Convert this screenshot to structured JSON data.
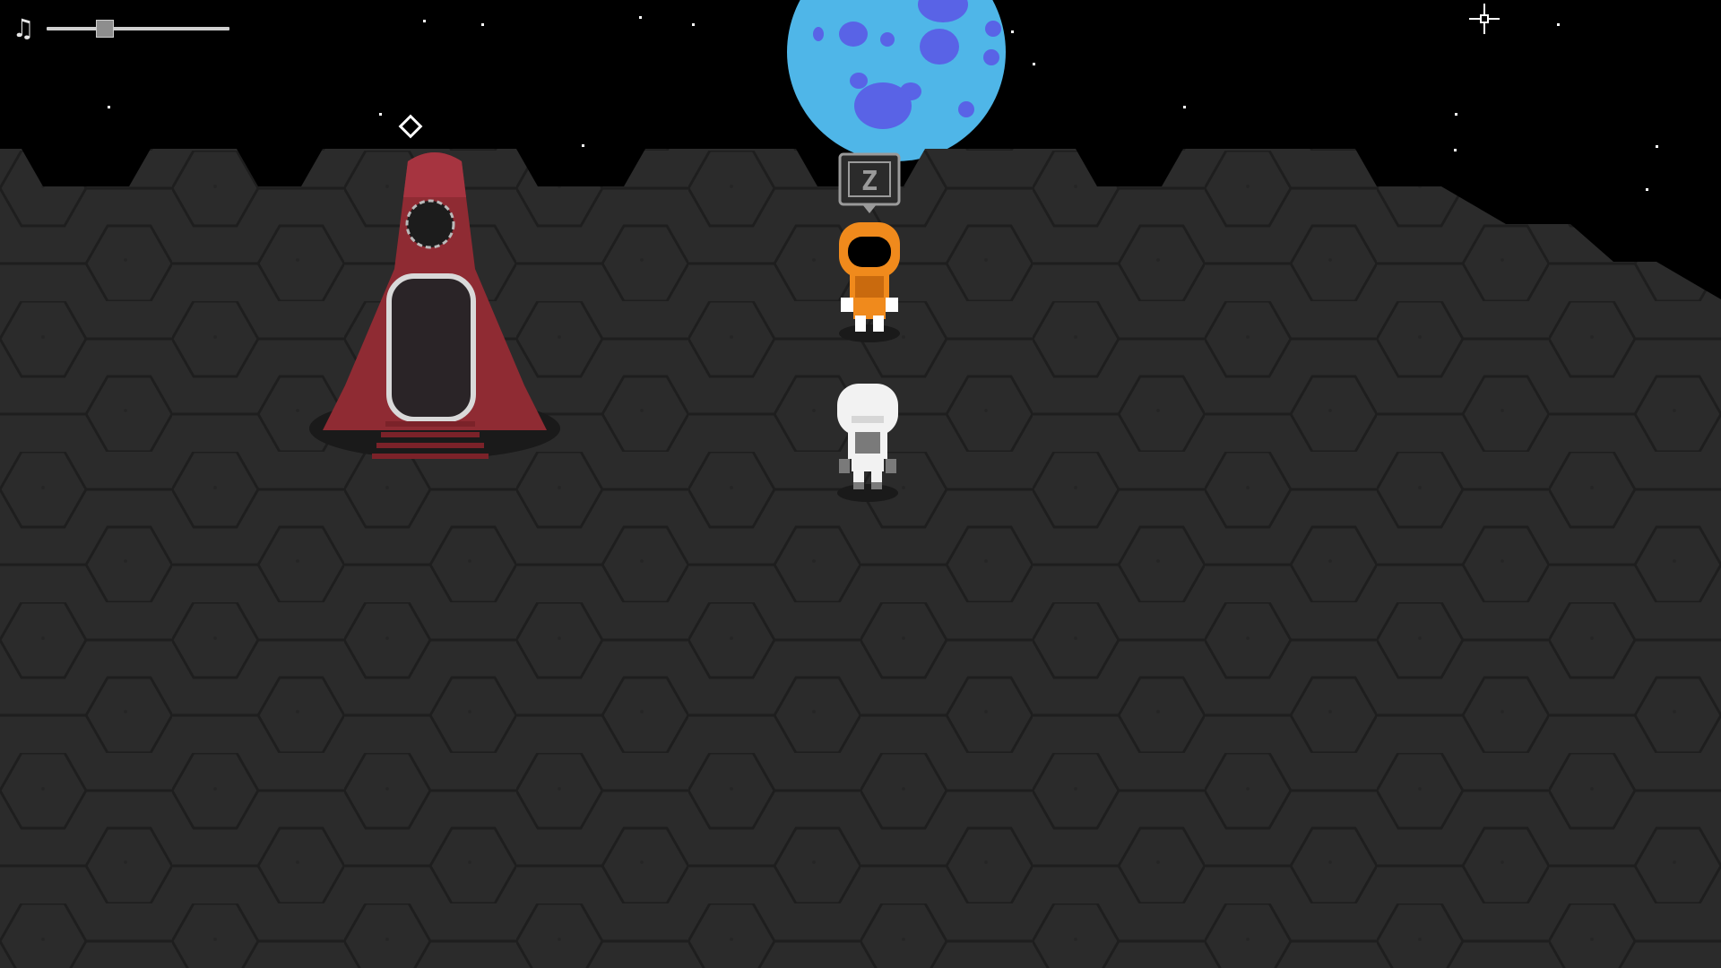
{
  "hud": {
    "music_icon": "music-note-icon",
    "volume_level": 0.3
  },
  "prompt": {
    "key_label": "Z"
  },
  "colors": {
    "sky": "#000000",
    "ground": "#2b2b2b",
    "hex_line": "#1f1f1f",
    "planet": "#4fb6e8",
    "planet_crater": "#5963e6",
    "rocket": "#8f2b33",
    "astronaut_orange": "#f08a1c",
    "astronaut_white": "#f2f2f2"
  }
}
